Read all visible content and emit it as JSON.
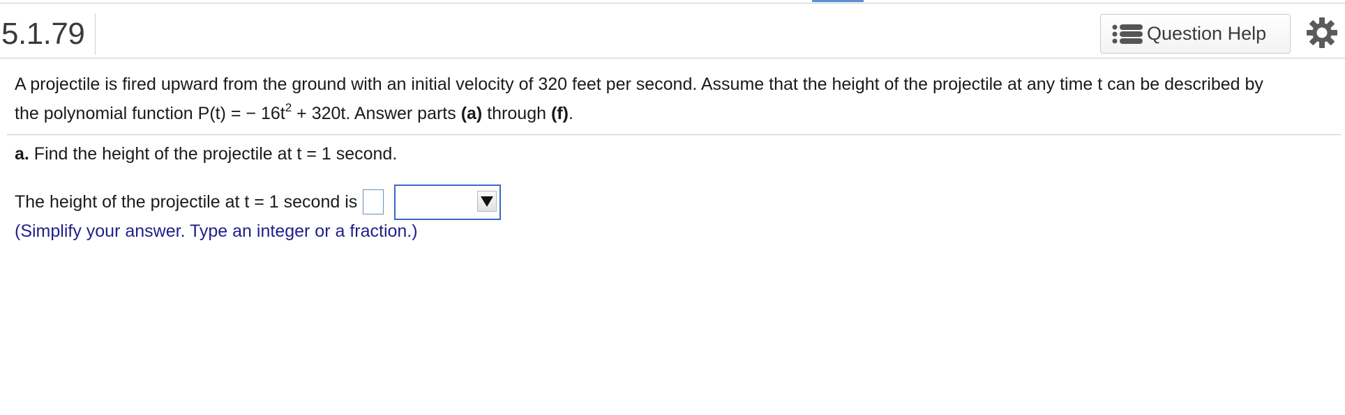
{
  "header": {
    "question_number": "5.1.79",
    "help_label": "Question Help",
    "help_icon": "list-icon",
    "settings_icon": "gear-icon"
  },
  "intro": {
    "line1": "A projectile is fired upward from the ground with an initial velocity of 320 feet per second.  Assume that the height of the projectile at any time t can be described by",
    "line2_prefix": "the polynomial function P(t) = − 16t",
    "exponent": "2",
    "line2_suffix": " + 320t. Answer parts ",
    "part_first": "(a)",
    "through": " through ",
    "part_last": "(f)",
    "period": "."
  },
  "part_a": {
    "label": "a.",
    "question": " Find the height of the projectile at t = 1 second."
  },
  "answer": {
    "prompt": "The height of the projectile at t = 1 second is",
    "value": "",
    "unit_selected": ""
  },
  "hint": "(Simplify your answer. Type an integer or a fraction.)"
}
